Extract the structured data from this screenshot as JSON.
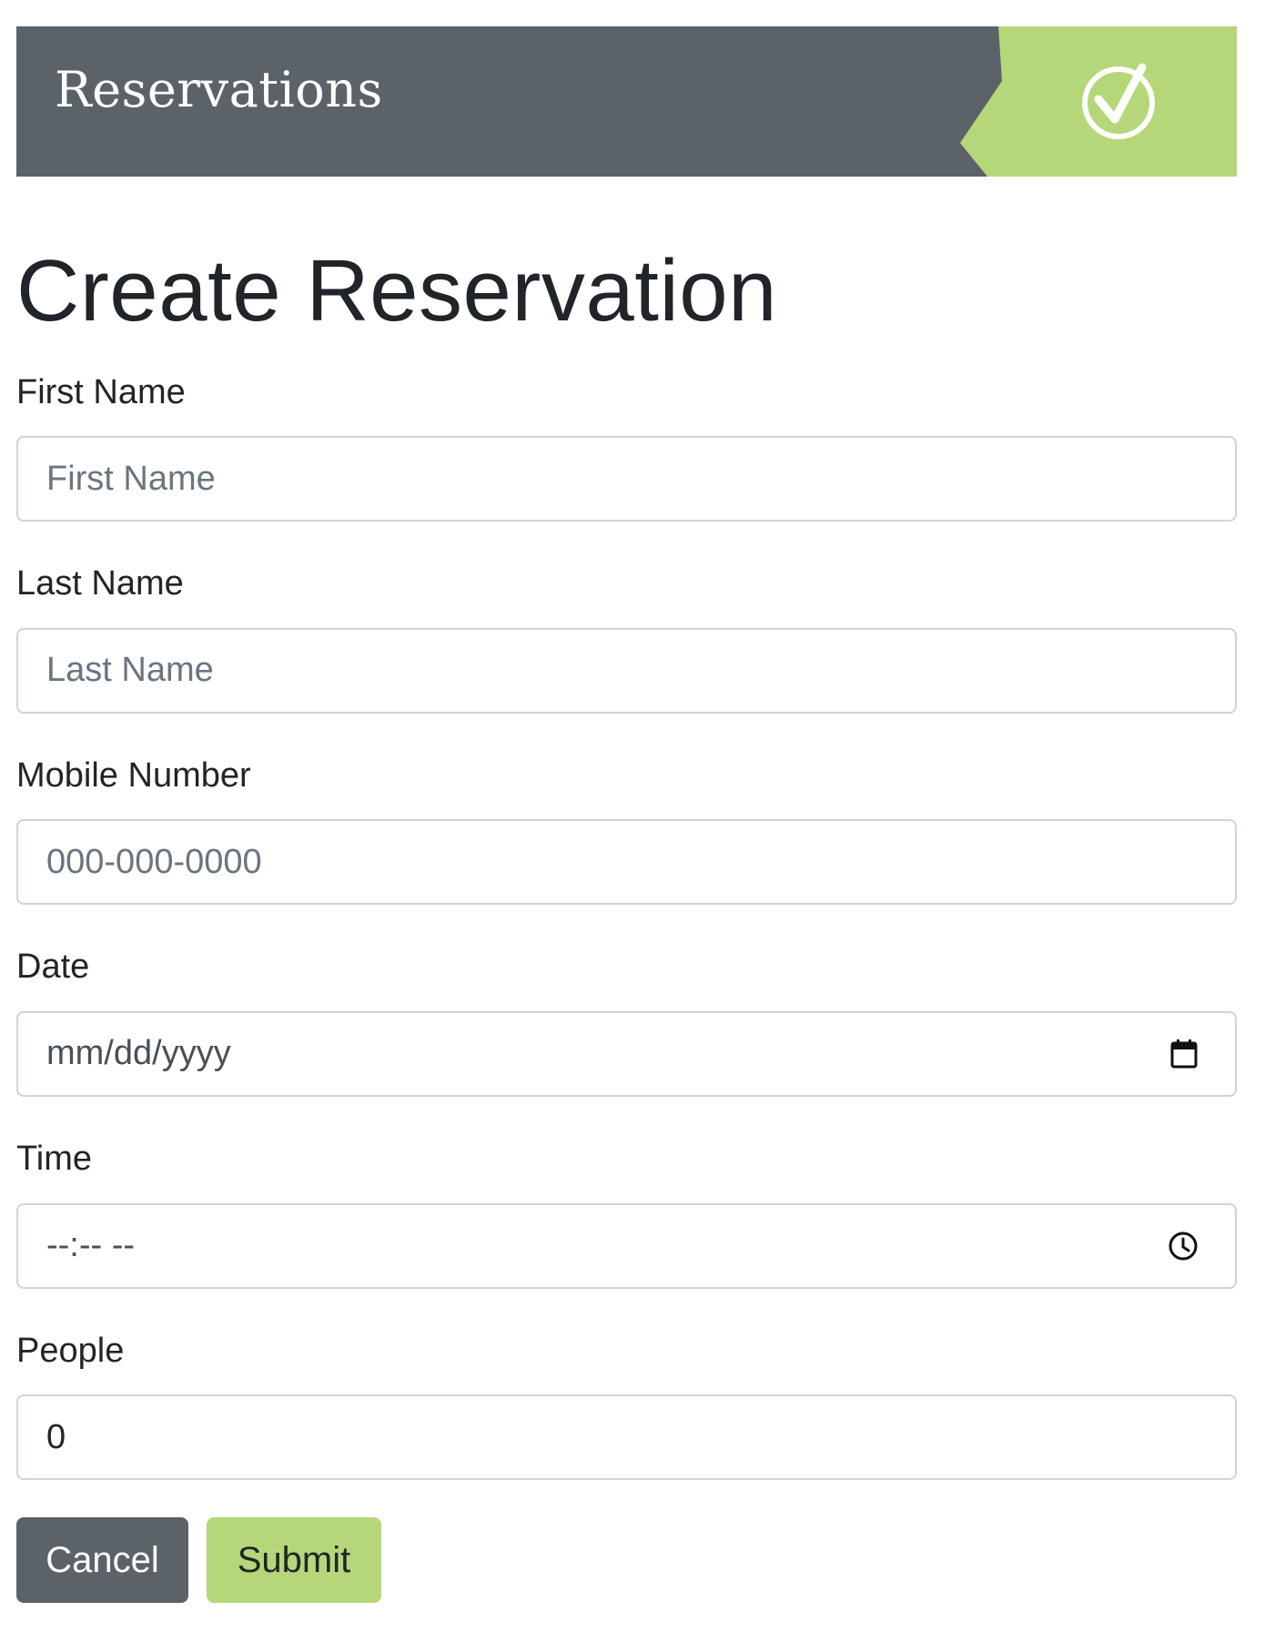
{
  "header": {
    "title": "Reservations",
    "icon": "check-circle-icon",
    "colors": {
      "banner": "#5b6369",
      "accent": "#b5d77a"
    }
  },
  "page": {
    "title": "Create Reservation"
  },
  "form": {
    "first_name": {
      "label": "First Name",
      "placeholder": "First Name"
    },
    "last_name": {
      "label": "Last Name",
      "placeholder": "Last Name"
    },
    "mobile_number": {
      "label": "Mobile Number",
      "placeholder": "000-000-0000"
    },
    "date": {
      "label": "Date",
      "placeholder": "mm/dd/yyyy",
      "icon": "calendar-icon"
    },
    "time": {
      "label": "Time",
      "placeholder": "--:-- --",
      "icon": "clock-icon"
    },
    "people": {
      "label": "People",
      "value": "0"
    }
  },
  "buttons": {
    "cancel": "Cancel",
    "submit": "Submit"
  }
}
